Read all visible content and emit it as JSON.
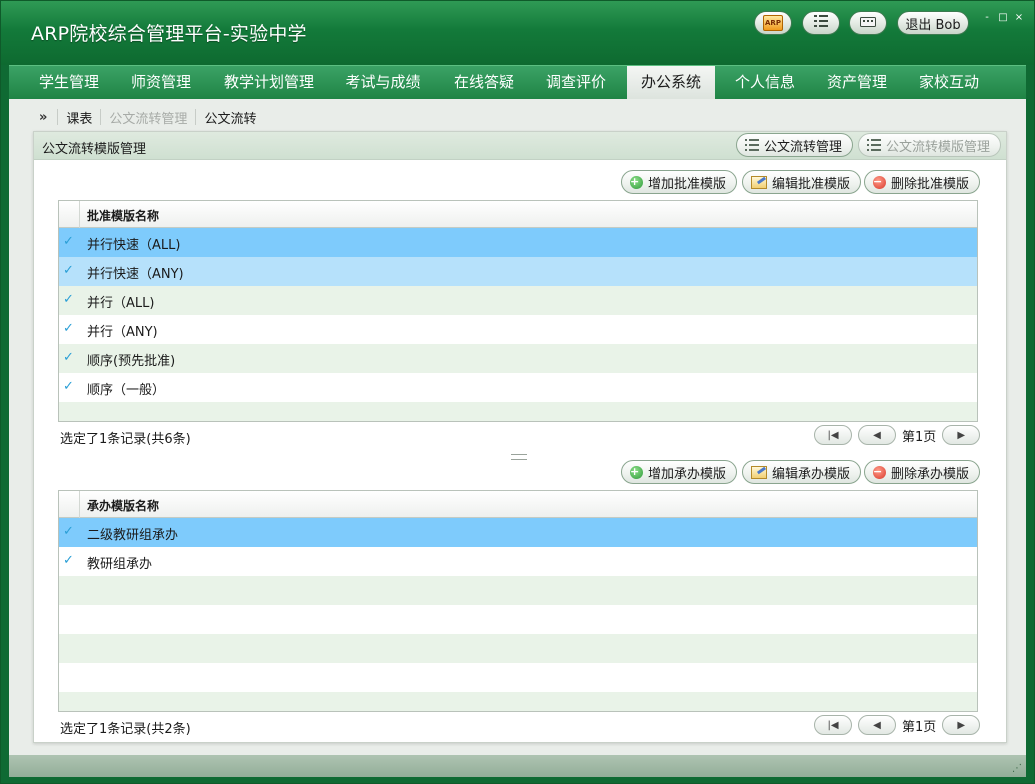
{
  "app": {
    "title": "ARP院校综合管理平台-实验中学",
    "arp_badge": "ARP",
    "logout_label": "退出 Bob",
    "window_controls": [
      "-",
      "□",
      "×"
    ]
  },
  "nav": {
    "items": [
      {
        "label": "学生管理",
        "active": false
      },
      {
        "label": "师资管理",
        "active": false
      },
      {
        "label": "教学计划管理",
        "active": false
      },
      {
        "label": "考试与成绩",
        "active": false
      },
      {
        "label": "在线答疑",
        "active": false
      },
      {
        "label": "调查评价",
        "active": false
      },
      {
        "label": "办公系统",
        "active": true
      },
      {
        "label": "个人信息",
        "active": false
      },
      {
        "label": "资产管理",
        "active": false
      },
      {
        "label": "家校互动",
        "active": false
      }
    ]
  },
  "breadcrumb": {
    "arrow": "»",
    "items": [
      {
        "label": "课表",
        "enabled": true
      },
      {
        "label": "公文流转管理",
        "enabled": false
      },
      {
        "label": "公文流转",
        "enabled": true
      }
    ]
  },
  "panel": {
    "title": "公文流转模版管理",
    "header_buttons": [
      {
        "label": "公文流转管理",
        "enabled": true
      },
      {
        "label": "公文流转模版管理",
        "enabled": false
      }
    ]
  },
  "approval": {
    "buttons": {
      "add": "增加批准模版",
      "edit": "编辑批准模版",
      "delete": "删除批准模版"
    },
    "column": "批准模版名称",
    "rows": [
      {
        "name": "并行快速（ALL)",
        "state": "selected"
      },
      {
        "name": "并行快速（ANY)",
        "state": "hover"
      },
      {
        "name": "并行（ALL)",
        "state": "normal"
      },
      {
        "name": "并行（ANY)",
        "state": "normal"
      },
      {
        "name": "顺序(预先批准)",
        "state": "normal"
      },
      {
        "name": "顺序（一般）",
        "state": "normal"
      }
    ],
    "status": "选定了1条记录(共6条)",
    "page_label": "第1页"
  },
  "handling": {
    "buttons": {
      "add": "增加承办模版",
      "edit": "编辑承办模版",
      "delete": "删除承办模版"
    },
    "column": "承办模版名称",
    "rows": [
      {
        "name": "二级教研组承办",
        "state": "selected"
      },
      {
        "name": "教研组承办",
        "state": "normal"
      }
    ],
    "status": "选定了1条记录(共2条)",
    "page_label": "第1页"
  },
  "check_mark": "✓",
  "colors": {
    "title_green": "#137a3a",
    "nav_green": "#2a9052",
    "row_selected": "#7ecbfc",
    "row_hover": "#b6e1fb",
    "row_alt": "#e9f3e8"
  }
}
